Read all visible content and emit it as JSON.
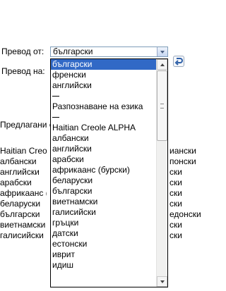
{
  "form": {
    "from_label": "Превод от:",
    "to_label": "Превод на:",
    "suggested_label": "Предлагани е",
    "selected_value": "български"
  },
  "dropdown_options": [
    {
      "label": "български",
      "selected": true
    },
    {
      "label": "френски"
    },
    {
      "label": "английски"
    },
    {
      "label": "",
      "separator": true
    },
    {
      "label": "Разпознаване на езика"
    },
    {
      "label": "",
      "separator": true
    },
    {
      "label": "Haitian Creole ALPHA"
    },
    {
      "label": "албански"
    },
    {
      "label": "английски"
    },
    {
      "label": "арабски"
    },
    {
      "label": "африкаанс (бурски)"
    },
    {
      "label": "беларуски"
    },
    {
      "label": "български"
    },
    {
      "label": "виетнамски"
    },
    {
      "label": "галисийски"
    },
    {
      "label": "гръцки"
    },
    {
      "label": "датски"
    },
    {
      "label": "естонски"
    },
    {
      "label": "иврит"
    },
    {
      "label": "идиш"
    }
  ],
  "background_left": [
    "Haitian Creole",
    "албански",
    "английски",
    "арабски",
    "африкаанс (б",
    "беларуски",
    "български",
    "виетнамски",
    "галисийски"
  ],
  "background_right": [
    "иански",
    "понски",
    "ски",
    "ски",
    "ски",
    "ски",
    "едонски",
    "ски",
    "ски"
  ]
}
